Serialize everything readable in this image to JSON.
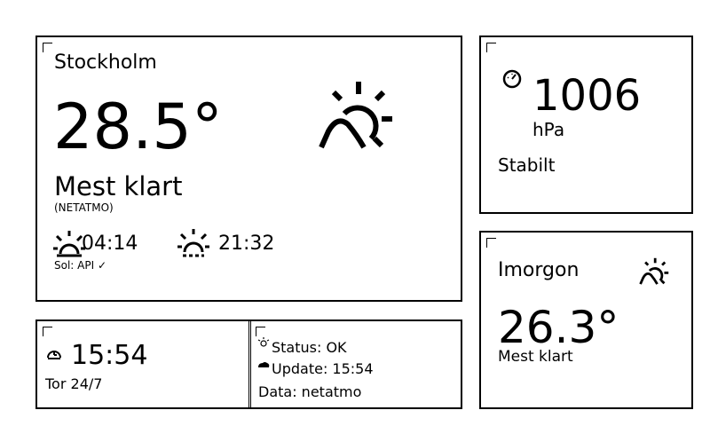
{
  "main": {
    "city": "Stockholm",
    "temperature": "28.5°",
    "condition": "Mest klart",
    "source": "(NETATMO)",
    "sunrise": "04:14",
    "sunset": "21:32",
    "sun_source": "Sol: API ✓",
    "weather_icon": "partly-sunny-icon"
  },
  "pressure": {
    "value": "1006",
    "unit": "hPa",
    "trend": "Stabilt",
    "icon": "gauge-icon"
  },
  "tomorrow": {
    "label": "Imorgon",
    "temperature": "26.3°",
    "condition": "Mest klart",
    "icon": "partly-sunny-icon"
  },
  "clock": {
    "time": "15:54",
    "date": "Tor 24/7",
    "icon": "clock-icon"
  },
  "status": {
    "status_text": "Status: OK",
    "update_text": "Update: 15:54",
    "data_text": "Data: netatmo"
  }
}
